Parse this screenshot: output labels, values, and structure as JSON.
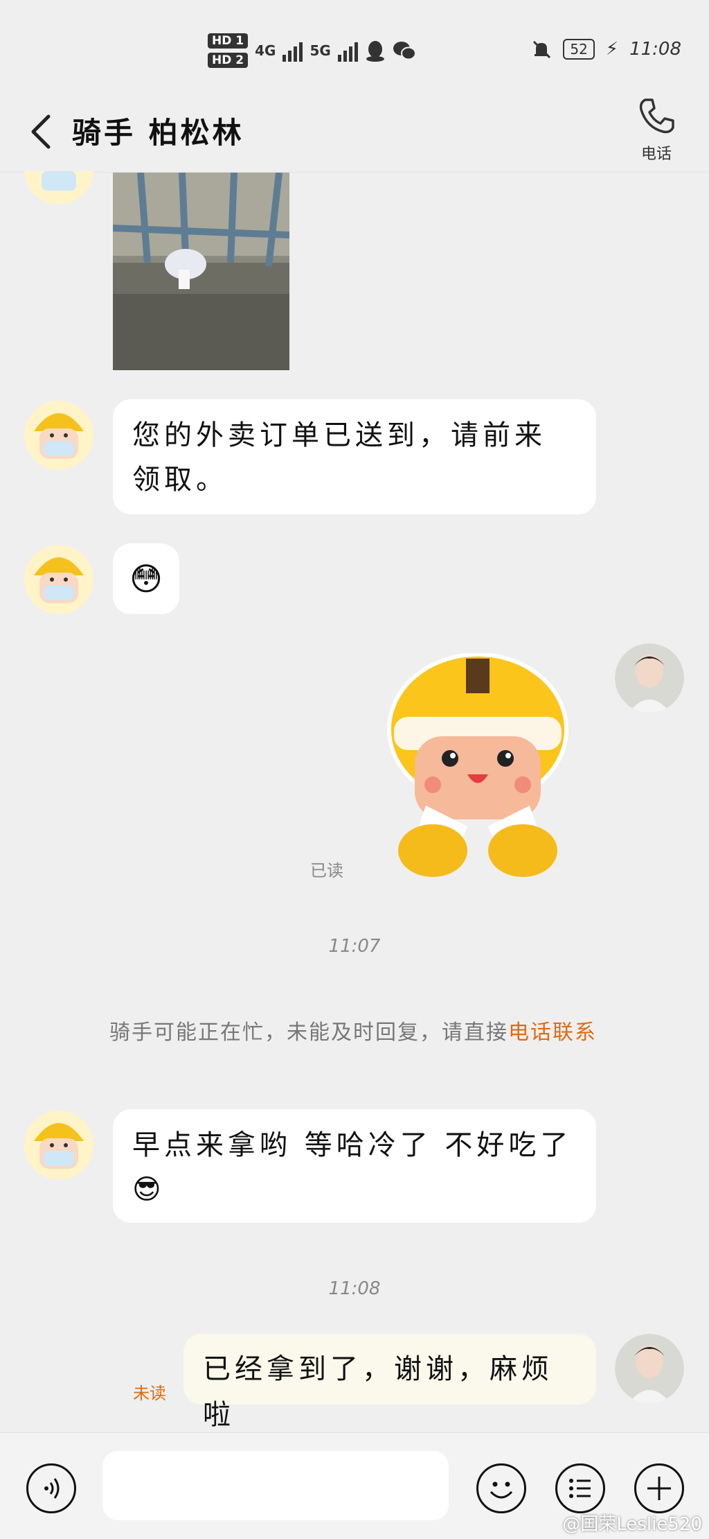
{
  "status_bar": {
    "sim1": "HD 1",
    "sim2": "HD 2",
    "net1": "4G",
    "net2": "5G",
    "battery": "52",
    "time": "11:08"
  },
  "header": {
    "title": "骑手 柏松林",
    "phone_label": "电话"
  },
  "messages": {
    "rider_text_1": "您的外卖订单已送到，请前来领取。",
    "rider_emoji_1": "😳",
    "read_label": "已读",
    "time_1": "11:07",
    "notice_text": "骑手可能正在忙，未能及时回复，请直接",
    "notice_link": "电话联系",
    "rider_text_2": "早点来拿哟 等哈冷了 不好吃了",
    "rider_emoji_2": "😎",
    "time_2": "11:08",
    "my_text": "已经拿到了，谢谢，麻烦啦",
    "unread_label": "未读"
  },
  "watermark": "@国荣Leslie520",
  "colors": {
    "background": "#efefef",
    "accent": "#e06a10",
    "my_bubble": "#fbf9ec"
  }
}
